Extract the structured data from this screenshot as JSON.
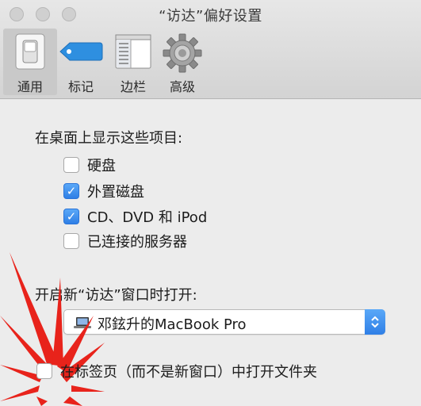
{
  "window": {
    "title": "“访达”偏好设置"
  },
  "tabs": [
    {
      "label": "通用",
      "icon": "light-switch-icon",
      "selected": true
    },
    {
      "label": "标记",
      "icon": "tag-icon",
      "selected": false
    },
    {
      "label": "边栏",
      "icon": "sidebar-icon",
      "selected": false
    },
    {
      "label": "高级",
      "icon": "gear-icon",
      "selected": false
    }
  ],
  "desktop": {
    "heading": "在桌面上显示这些项目:",
    "items": [
      {
        "label": "硬盘",
        "checked": false
      },
      {
        "label": "外置磁盘",
        "checked": true
      },
      {
        "label": "CD、DVD 和 iPod",
        "checked": true
      },
      {
        "label": "已连接的服务器",
        "checked": false
      }
    ]
  },
  "new_window": {
    "heading": "开启新“访达”窗口时打开:",
    "selected": "邓鉉升的MacBook Pro"
  },
  "open_in_tabs": {
    "label": "在标签页（而不是新窗口）中打开文件夹",
    "checked": false
  },
  "colors": {
    "accent": "#2f7fe6",
    "annotation": "#e8231b"
  }
}
